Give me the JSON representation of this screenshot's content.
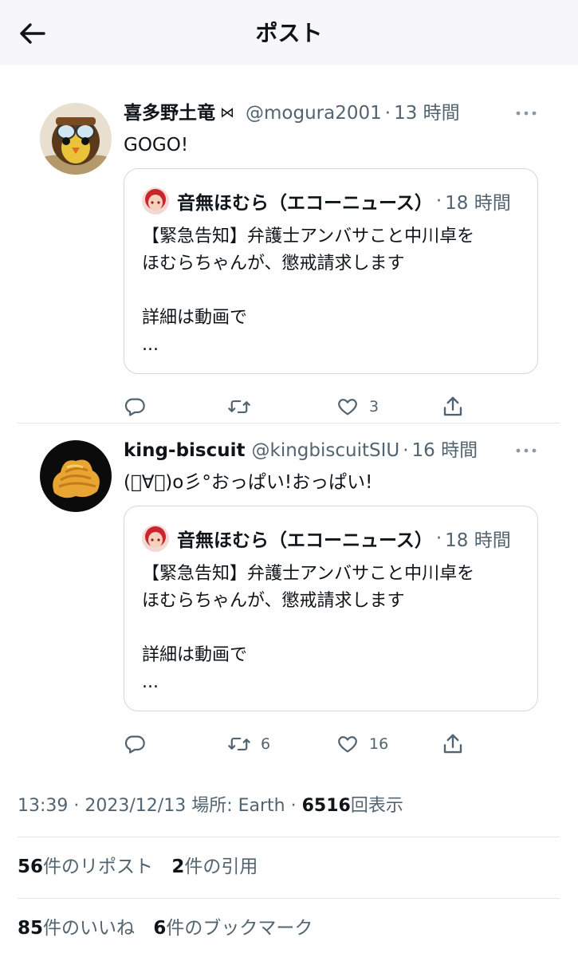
{
  "header": {
    "title": "ポスト"
  },
  "replies": [
    {
      "name": "喜多野土竜",
      "badge": "⋈",
      "handle": "@mogura2001",
      "sep": "·",
      "time": "13 時間",
      "text": "GOGO!",
      "quote": {
        "name": "音無ほむら（エコーニュース）",
        "sep": "·",
        "time": "18 時間",
        "lines": [
          "【緊急告知】弁護士アンバサこと中川卓を",
          "ほむらちゃんが、懲戒請求します",
          "",
          "詳細は動画で",
          "..."
        ]
      },
      "actions": {
        "reply": "",
        "retweet": "",
        "like": "3"
      }
    },
    {
      "name": "king-biscuit",
      "badge": "",
      "handle": "@kingbiscuitSIU",
      "sep": "·",
      "time": "16 時間",
      "text": "(ﾟ∀ﾟ)o彡°おっぱい!おっぱい!",
      "quote": {
        "name": "音無ほむら（エコーニュース）",
        "sep": "·",
        "time": "18 時間",
        "lines": [
          "【緊急告知】弁護士アンバサこと中川卓を",
          "ほむらちゃんが、懲戒請求します",
          "",
          "詳細は動画で",
          "..."
        ]
      },
      "actions": {
        "reply": "",
        "retweet": "6",
        "like": "16"
      }
    }
  ],
  "post_meta": {
    "time": "13:39",
    "sep1": "·",
    "date": "2023/12/13",
    "location": "場所: Earth",
    "sep2": "·",
    "views_count": "6516",
    "views_label": "回表示"
  },
  "stats": {
    "reposts_count": "56",
    "reposts_label": "件のリポスト",
    "quotes_count": "2",
    "quotes_label": "件の引用",
    "likes_count": "85",
    "likes_label": "件のいいね",
    "bookmarks_count": "6",
    "bookmarks_label": "件のブックマーク"
  },
  "colors": {
    "text": "#0f1419",
    "secondary": "#536471",
    "border": "#cfd9de",
    "header_bg": "#f7f7f9"
  },
  "icons": [
    "back-arrow-icon",
    "more-icon",
    "reply-icon",
    "retweet-icon",
    "like-icon",
    "share-icon"
  ]
}
